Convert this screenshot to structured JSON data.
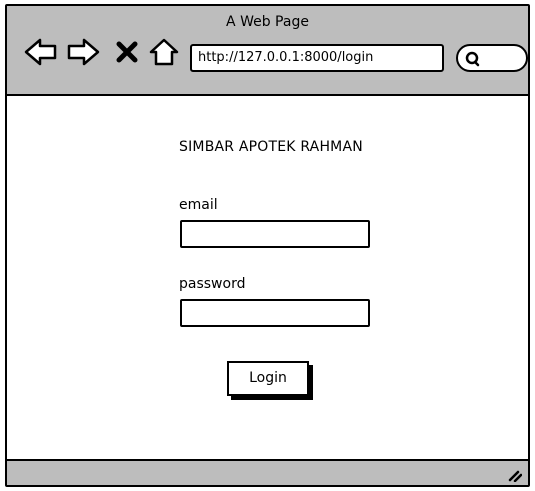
{
  "window": {
    "title": "A Web Page"
  },
  "toolbar": {
    "back_icon": "back-arrow-icon",
    "forward_icon": "forward-arrow-icon",
    "stop_icon": "close-icon",
    "home_icon": "home-icon",
    "url": "http://127.0.0.1:8000/login",
    "search_icon": "search-icon"
  },
  "page": {
    "heading": "SIMBAR APOTEK RAHMAN",
    "email_label": "email",
    "password_label": "password",
    "login_button": "Login"
  }
}
